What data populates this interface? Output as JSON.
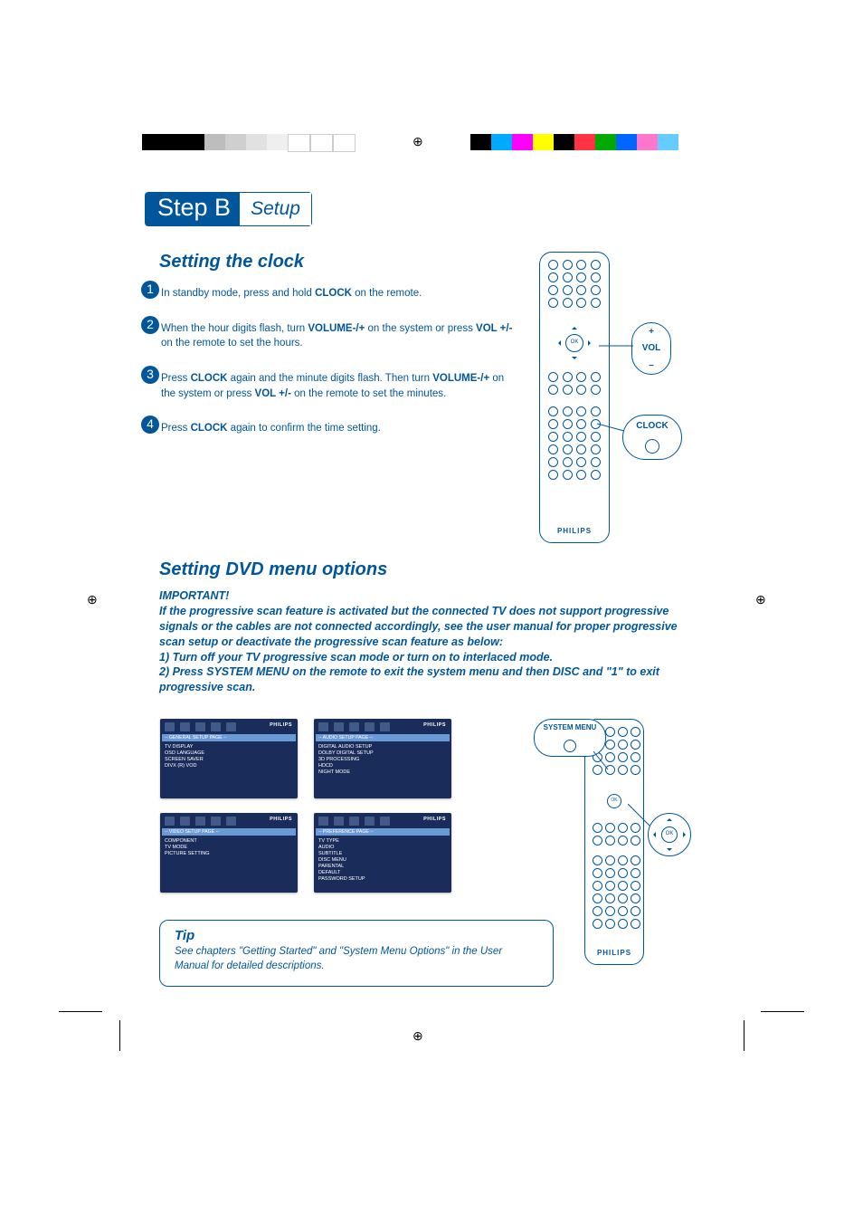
{
  "header": {
    "step": "Step B",
    "section": "Setup"
  },
  "heading_clock": "Setting the clock",
  "steps": [
    {
      "num": "1",
      "pre": "In standby mode, press and hold ",
      "b1": "CLOCK",
      "post": " on the remote."
    },
    {
      "num": "2",
      "pre": "When the hour digits flash, turn ",
      "b1": "VOLUME-/+",
      "mid": " on the system or press ",
      "b2": "VOL +/-",
      "post": " on the remote to set the hours."
    },
    {
      "num": "3",
      "pre": "Press ",
      "b1": "CLOCK",
      "mid": " again and the minute digits flash. Then turn ",
      "b2": "VOLUME-/+",
      "mid2": " on the system or press ",
      "b3": "VOL +/-",
      "post": " on the remote to set the minutes."
    },
    {
      "num": "4",
      "pre": "Press ",
      "b1": "CLOCK",
      "post": " again to confirm the time setting."
    }
  ],
  "callouts1": {
    "vol_plus": "+",
    "vol": "VOL",
    "vol_minus": "–",
    "clock": "CLOCK"
  },
  "heading_dvd": "Setting DVD menu options",
  "important": {
    "title": "IMPORTANT!",
    "p1": "If the progressive scan feature is activated but the connected TV does not support progressive signals or the cables are not connected accordingly, see the user manual for proper progressive scan setup or deactivate the progressive scan feature as below:",
    "l1": "1) Turn off your TV progressive scan mode or turn on to interlaced mode.",
    "l2": "2) Press SYSTEM MENU on the remote to exit the system menu and then DISC and \"1\" to exit progressive scan."
  },
  "osd_brand": "PHILIPS",
  "osd": {
    "general": {
      "bar": "-- GENERAL SETUP PAGE --",
      "items": [
        "TV DISPLAY",
        "OSD LANGUAGE",
        "SCREEN SAVER",
        "DIVX (R) VOD"
      ]
    },
    "audio": {
      "bar": "-- AUDIO SETUP PAGE --",
      "items": [
        "DIGITAL AUDIO SETUP",
        "DOLBY DIGITAL SETUP",
        "3D PROCESSING",
        "HDCD",
        "NIGHT MODE"
      ]
    },
    "video": {
      "bar": "-- VIDEO SETUP PAGE --",
      "items": [
        "COMPONENT",
        "TV MODE",
        "PICTURE SETTING"
      ]
    },
    "pref": {
      "bar": "-- PREFERENCE PAGE --",
      "items": [
        "TV TYPE",
        "AUDIO",
        "SUBTITLE",
        "DISC MENU",
        "PARENTAL",
        "DEFAULT",
        "PASSWORD SETUP"
      ]
    }
  },
  "tip": {
    "title": "Tip",
    "body": "See chapters \"Getting Started\" and \"System Menu Options\" in the User Manual for detailed descriptions."
  },
  "callouts2": {
    "system_menu": "SYSTEM MENU",
    "ok": "OK"
  },
  "remote_brand": "PHILIPS",
  "remote_ok": "OK",
  "colors": {
    "left": [
      "#000",
      "#000",
      "#000",
      "#bbb",
      "#ccc",
      "#ddd",
      "#eee",
      "#fff",
      "#fff",
      "#fff"
    ],
    "right": [
      "#000",
      "#08f",
      "#f0f",
      "#ff0",
      "#000",
      "#f33",
      "#0a0",
      "#08f",
      "#f6c",
      "#5bf"
    ]
  }
}
